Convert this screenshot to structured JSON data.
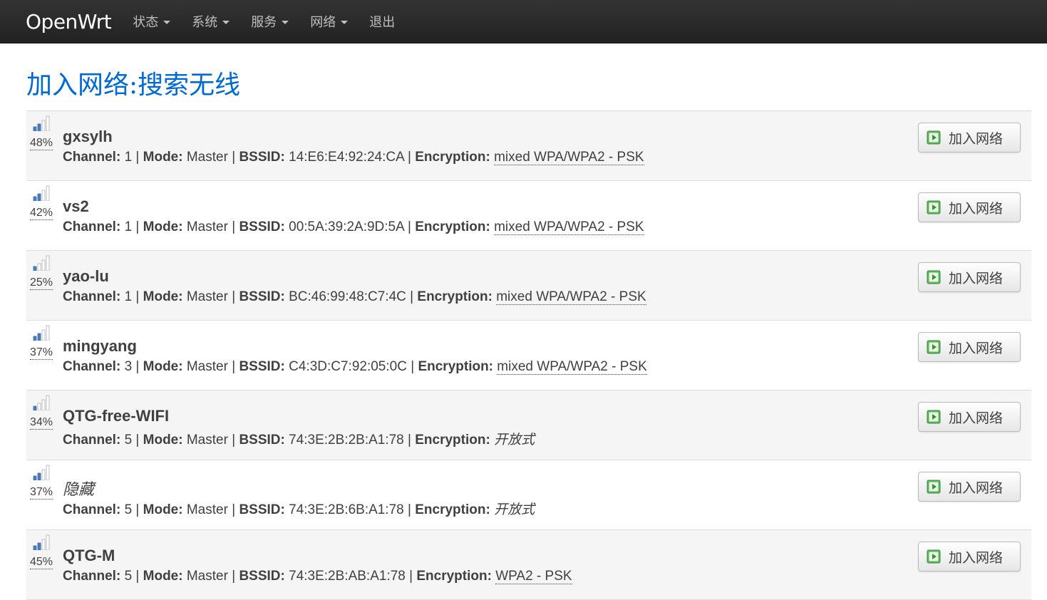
{
  "navbar": {
    "brand": "OpenWrt",
    "menu": [
      {
        "label": "状态",
        "dropdown": true
      },
      {
        "label": "系统",
        "dropdown": true
      },
      {
        "label": "服务",
        "dropdown": true
      },
      {
        "label": "网络",
        "dropdown": true
      },
      {
        "label": "退出",
        "dropdown": false
      }
    ]
  },
  "page": {
    "title": "加入网络:搜索无线"
  },
  "labels": {
    "channel": "Channel:",
    "mode": "Mode:",
    "bssid": "BSSID:",
    "encryption": "Encryption:",
    "separator": " | ",
    "join_button": "加入网络"
  },
  "colors": {
    "title": "#0069d6",
    "navbar": "#222222",
    "button_icon": "#5cb85c"
  },
  "networks": [
    {
      "signal_pct": "48%",
      "signal_bars": 2,
      "ssid": "gxsylh",
      "hidden": false,
      "channel": "1",
      "mode": "Master",
      "bssid": "14:E6:E4:92:24:CA",
      "encryption": "mixed WPA/WPA2 - PSK",
      "open": false
    },
    {
      "signal_pct": "42%",
      "signal_bars": 2,
      "ssid": "vs2",
      "hidden": false,
      "channel": "1",
      "mode": "Master",
      "bssid": "00:5A:39:2A:9D:5A",
      "encryption": "mixed WPA/WPA2 - PSK",
      "open": false
    },
    {
      "signal_pct": "25%",
      "signal_bars": 1,
      "ssid": "yao-lu",
      "hidden": false,
      "channel": "1",
      "mode": "Master",
      "bssid": "BC:46:99:48:C7:4C",
      "encryption": "mixed WPA/WPA2 - PSK",
      "open": false
    },
    {
      "signal_pct": "37%",
      "signal_bars": 2,
      "ssid": "mingyang",
      "hidden": false,
      "channel": "3",
      "mode": "Master",
      "bssid": "C4:3D:C7:92:05:0C",
      "encryption": "mixed WPA/WPA2 - PSK",
      "open": false
    },
    {
      "signal_pct": "34%",
      "signal_bars": 1,
      "ssid": "QTG-free-WIFI",
      "hidden": false,
      "channel": "5",
      "mode": "Master",
      "bssid": "74:3E:2B:2B:A1:78",
      "encryption": "开放式",
      "open": true
    },
    {
      "signal_pct": "37%",
      "signal_bars": 2,
      "ssid": "隐藏",
      "hidden": true,
      "channel": "5",
      "mode": "Master",
      "bssid": "74:3E:2B:6B:A1:78",
      "encryption": "开放式",
      "open": true
    },
    {
      "signal_pct": "45%",
      "signal_bars": 2,
      "ssid": "QTG-M",
      "hidden": false,
      "channel": "5",
      "mode": "Master",
      "bssid": "74:3E:2B:AB:A1:78",
      "encryption": "WPA2 - PSK",
      "open": false
    }
  ]
}
